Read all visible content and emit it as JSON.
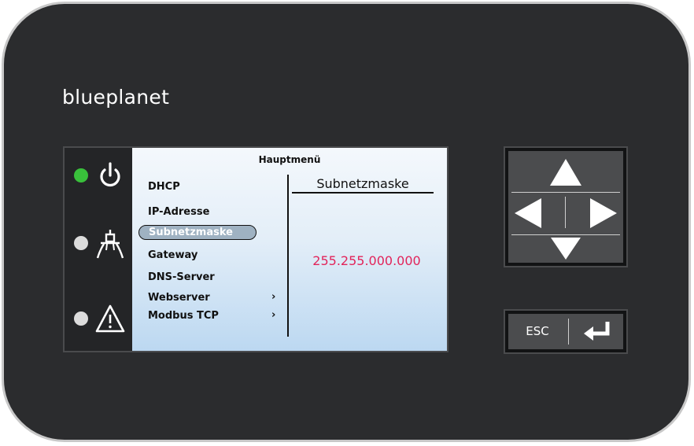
{
  "device": {
    "brand": "blueplanet"
  },
  "status_leds": [
    {
      "name": "operation",
      "color": "#39c03b",
      "icon": "power-icon"
    },
    {
      "name": "feed-in",
      "color": "#dcdcdc",
      "icon": "grid-tower-icon"
    },
    {
      "name": "fault",
      "color": "#dcdcdc",
      "icon": "warning-icon"
    }
  ],
  "screen": {
    "title": "Hauptmenü",
    "menu": [
      {
        "label": "DHCP",
        "has_submenu": false,
        "selected": false
      },
      {
        "label": "IP-Adresse",
        "has_submenu": false,
        "selected": false
      },
      {
        "label": "Subnetzmaske",
        "has_submenu": false,
        "selected": true
      },
      {
        "label": "Gateway",
        "has_submenu": false,
        "selected": false
      },
      {
        "label": "DNS-Server",
        "has_submenu": false,
        "selected": false
      },
      {
        "label": "Webserver",
        "has_submenu": true,
        "selected": false
      },
      {
        "label": "Modbus TCP",
        "has_submenu": true,
        "selected": false
      }
    ],
    "submenu_glyph": "›",
    "detail_title": "Subnetzmaske",
    "detail_value": "255.255.000.000",
    "detail_value_color": "#e2245a"
  },
  "keys": {
    "esc_label": "ESC",
    "enter_icon": "enter-icon",
    "dpad_icons": [
      "arrow-up-icon",
      "arrow-left-icon",
      "arrow-right-icon",
      "arrow-down-icon"
    ]
  }
}
